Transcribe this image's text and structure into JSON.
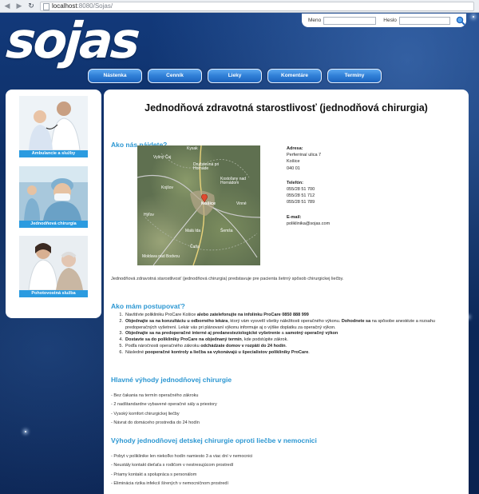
{
  "browser": {
    "url_host": "localhost",
    "url_path": ":8080/Sojas/"
  },
  "logo": {
    "text": "sojas"
  },
  "login": {
    "name_label": "Meno",
    "password_label": "Heslo"
  },
  "nav": {
    "items": [
      "Nástenka",
      "Cenník",
      "Lieky",
      "Komentáre",
      "Termíny"
    ]
  },
  "sidebar": {
    "items": [
      {
        "label": "Ambulancie a služby"
      },
      {
        "label": "Jednodňová chirurgia"
      },
      {
        "label": "Pohotovostná služba"
      }
    ]
  },
  "main": {
    "title": "Jednodňová zdravotná starostlivosť (jednodňová chirurgia)",
    "find_title": "Ako nás nájdete?",
    "map_places": [
      "Kysak",
      "Vyšný Čaj",
      "Družstevná pri Hornáde",
      "Kostoľany nad Hornádom",
      "Kojšov",
      "Košice",
      "Vinné",
      "Hýľov",
      "Šemša",
      "Malá Ida",
      "Čaňa",
      "Moldava nad Bodvou"
    ],
    "address_label": "Adresa:",
    "address_lines": [
      "Perferrinaí ulica 7",
      "Košice",
      "040 01"
    ],
    "phone_label": "Telefón:",
    "phone_lines": [
      "055/28 51 700",
      "055/28 51 712",
      "055/28 51 789"
    ],
    "email_label": "E-mail:",
    "email": "poliklinika@sojas.com",
    "intro": "Jednodňová zdravotná starostlivosť (jednodňová chirurgia) predstavuje pre pacienta šetrný spôsob chirurgickej liečby.",
    "how_title": "Ako mám postupovať?",
    "steps": [
      {
        "plain": "Navštívte polikliniku ProCare Košice ",
        "bold": "alebo zatelefonujte na infolinku ProCare 0850 888 999",
        "rest": ""
      },
      {
        "plain": "",
        "bold": "Objednajte sa na konzultáciu u odborného lekára",
        "rest": ", ktorý vám vysvetlí všetky náležitosti operačného výkonu. "
      },
      {
        "plain": "",
        "bold": "Dohodnete sa",
        "rest": " na spôsobe anestézie a rozsahu predoperačných vyšetrení. Lekár vás pri plánovaní výkonu informuje aj o výške doplatku za operačný výkon."
      },
      {
        "plain": "",
        "bold": "Objednajte sa na predoperačné interné aj predanesteziologické vyšetrenie",
        "rest": " a ",
        "bold2": "samotný operačný výkon"
      },
      {
        "plain": "",
        "bold": "Dostavte sa do polikliniky ProCare na objednaný termín",
        "rest": ", kde podstúpite zákrok."
      },
      {
        "plain": "Podľa náročnosti operačného zákroku ",
        "bold": "odchádzate domov v rozpätí do 24 hodín",
        "rest": "."
      },
      {
        "plain": "Následné ",
        "bold": "pooperačné kontroly a liečba sa vykonávajú u špecialistov polikliniky ProCare",
        "rest": "."
      }
    ],
    "benefits_title": "Hlavné výhody jednodňovej chirurgie",
    "benefits": [
      "- Bez čakania na termín operačného zákroku",
      "- 2 nadštandardne vybavené operačné sály a priestory",
      "- Vysoký komfort chirurgickej liečby",
      "- Návrat do domáceho prostredia do 24 hodín"
    ],
    "child_title": "Výhody jednodňovej detskej chirurgie oproti liečbe v nemocnici",
    "child_benefits": [
      "- Pobyt v poliklinike len niekoľko hodín namiesto 3 a viac dní v nemocnici",
      "- Neustály kontakt dieťaťa s rodičom v nestresujúcom prostredí",
      "- Priamy kontakt a spolupráca s personálom",
      "- Eliminácia rizika infekcií šírených v nemocničnom prostredí"
    ]
  }
}
